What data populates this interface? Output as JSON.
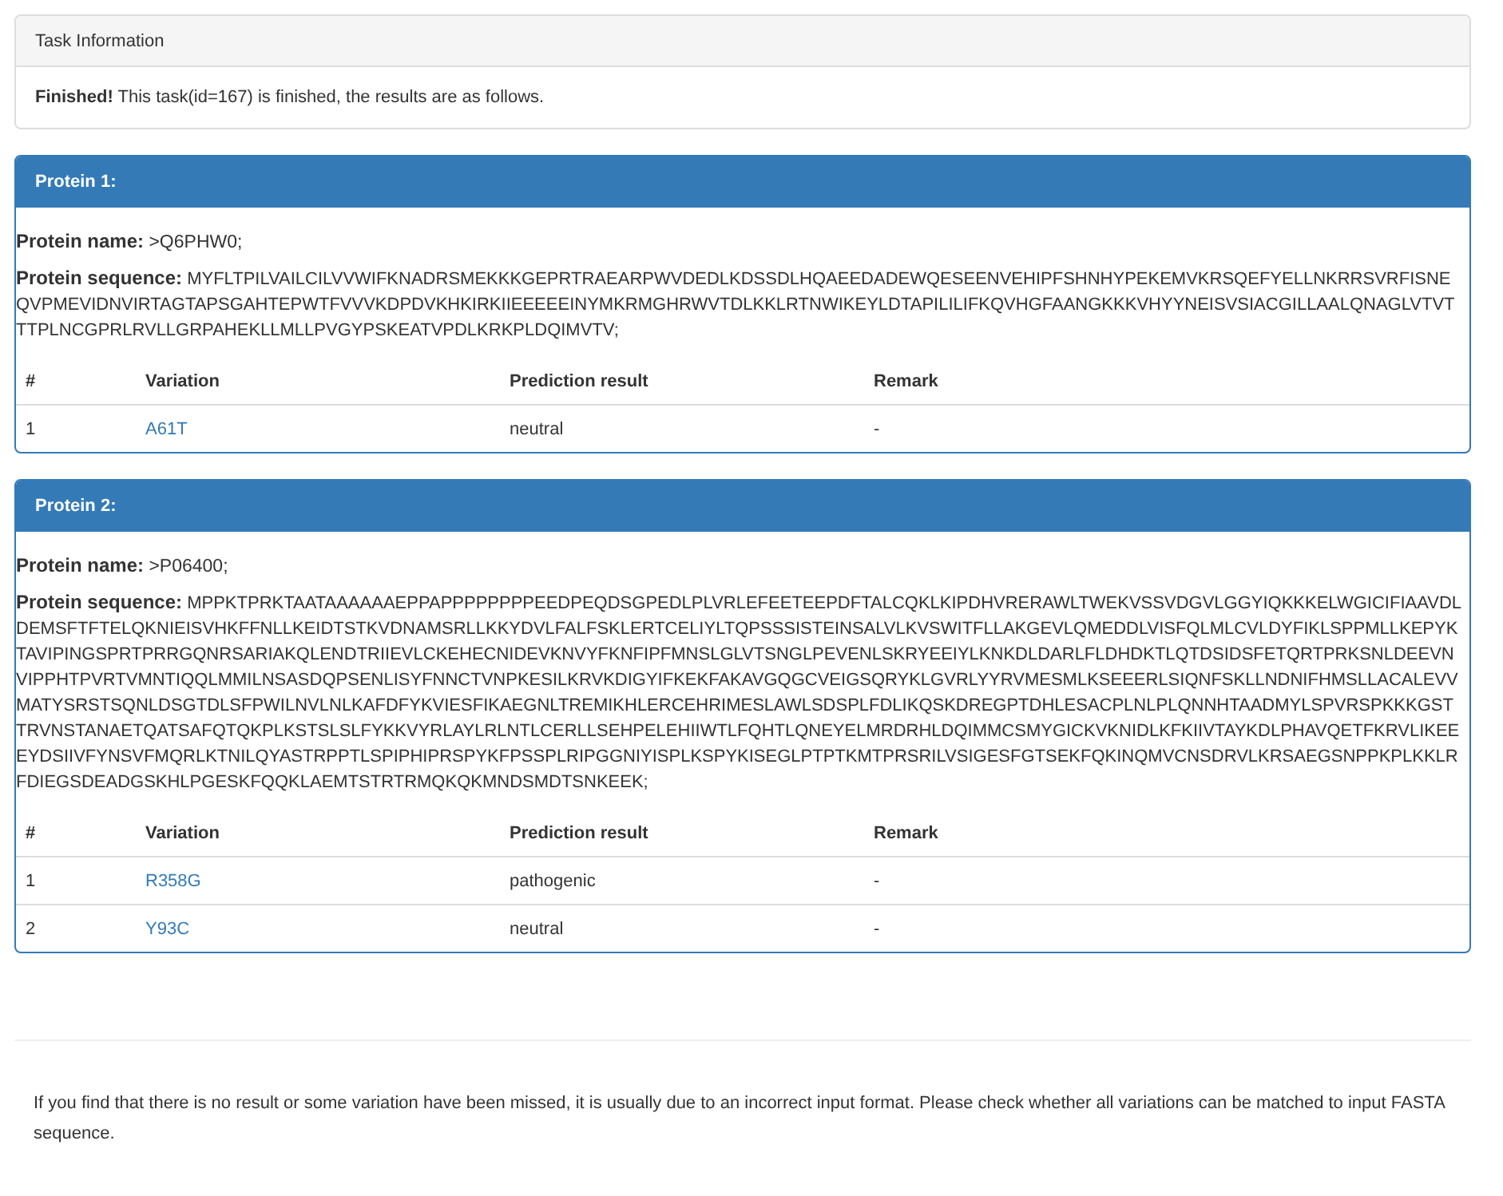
{
  "task_panel": {
    "title": "Task Information",
    "status": "Finished!",
    "message": "This task(id=167) is finished, the results are as follows."
  },
  "proteins": [
    {
      "title": "Protein 1:",
      "name_label": "Protein name:",
      "name": ">Q6PHW0;",
      "sequence_label": "Protein sequence:",
      "sequence": "MYFLTPILVAILCILVVWIFKNADRSMEKKKGEPRTRAEARPWVDEDLKDSSDLHQAEEDADEWQESEENVEHIPFSHNHYPEKEMVKRSQEFYELLNKRRSVRFISNEQVPMEVIDNVIRTAGTAPSGAHTEPWTFVVVKDPDVKHKIRKIIEEEEEINYMKRMGHRWVTDLKKLRTNWIKEYLDTAPILILIFKQVHGFAANGKKKVHYYNEISVSIACGILLAALQNAGLVTVTTTPLNCGPRLRVLLGRPAHEKLLMLLPVGYPSKEATVPDLKRKPLDQIMVTV;",
      "columns": [
        "#",
        "Variation",
        "Prediction result",
        "Remark"
      ],
      "rows": [
        {
          "index": "1",
          "variation": "A61T",
          "prediction": "neutral",
          "remark": "-"
        }
      ]
    },
    {
      "title": "Protein 2:",
      "name_label": "Protein name:",
      "name": ">P06400;",
      "sequence_label": "Protein sequence:",
      "sequence": "MPPKTPRKTAATAAAAAAEPPAPPPPPPPPEEDPEQDSGPEDLPLVRLEFEETEEPDFTALCQKLKIPDHVRERAWLTWEKVSSVDGVLGGYIQKKKELWGICIFIAAVDLDEMSFTFTELQKNIEISVHKFFNLLKEIDTSTKVDNAMSRLLKKYDVLFALFSKLERTCELIYLTQPSSSISTEINSALVLKVSWITFLLAKGEVLQMEDDLVISFQLMLCVLDYFIKLSPPMLLKEPYKTAVIPINGSPRTPRRGQNRSARIAKQLENDTRIIEVLCKEHECNIDEVKNVYFKNFIPFMNSLGLVTSNGLPEVENLSKRYEEIYLKNKDLDARLFLDHDKTLQTDSIDSFETQRTPRKSNLDEEVNVIPPHTPVRTVMNTIQQLMMILNSASDQPSENLISYFNNCTVNPKESILKRVKDIGYIFKEKFAKAVGQGCVEIGSQRYKLGVRLYYRVMESMLKSEEERLSIQNFSKLLNDNIFHMSLLACALEVVMATYSRSTSQNLDSGTDLSFPWILNVLNLKAFDFYKVIESFIKAEGNLTREMIKHLERCEHRIMESLAWLSDSPLFDLIKQSKDREGPTDHLESACPLNLPLQNNHTAADMYLSPVRSPKKKGSTTRVNSTANAETQATSAFQTQKPLKSTSLSLFYKKVYRLAYLRLNTLCERLLSEHPELEHIIWTLFQHTLQNEYELMRDRHLDQIMMCSMYGICKVKNIDLKFKIIVTAYKDLPHAVQETFKRVLIKEEEYDSIIVFYNSVFMQRLKTNILQYASTRPPTLSPIPHIPRSPYKFPSSPLRIPGGNIYISPLKSPYKISEGLPTPTKMTPRSRILVSIGESFGTSEKFQKINQMVCNSDRVLKRSAEGSNPPKPLKKLRFDIEGSDEADGSKHLPGESKFQQKLAEMTSTRTRMQKQKMNDSMDTSNKEEK;",
      "columns": [
        "#",
        "Variation",
        "Prediction result",
        "Remark"
      ],
      "rows": [
        {
          "index": "1",
          "variation": "R358G",
          "prediction": "pathogenic",
          "remark": "-"
        },
        {
          "index": "2",
          "variation": "Y93C",
          "prediction": "neutral",
          "remark": "-"
        }
      ]
    }
  ],
  "footer_note": "If you find that there is no result or some variation have been missed, it is usually due to an incorrect input format. Please check whether all variations can be matched to input FASTA sequence."
}
